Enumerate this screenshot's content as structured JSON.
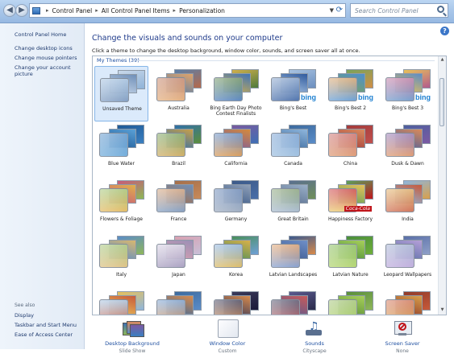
{
  "address": {
    "crumbs": [
      "Control Panel",
      "All Control Panel Items",
      "Personalization"
    ]
  },
  "search": {
    "placeholder": "Search Control Panel"
  },
  "sidebar": {
    "home": "Control Panel Home",
    "links": [
      "Change desktop icons",
      "Change mouse pointers",
      "Change your account picture"
    ],
    "see_also_label": "See also",
    "see_also": [
      "Display",
      "Taskbar and Start Menu",
      "Ease of Access Center"
    ]
  },
  "main": {
    "title": "Change the visuals and sounds on your computer",
    "subtitle": "Click a theme to change the desktop background, window color, sounds, and screen saver all at once.",
    "group_title": "My Themes (39)"
  },
  "themes": [
    {
      "name": "Unsaved Theme",
      "colors": [
        "#8fb3d8",
        "#6f8fb8",
        "#c9d8ea"
      ],
      "selected": true
    },
    {
      "name": "Australia",
      "colors": [
        "#b6694a",
        "#e0a36a",
        "#5a7fa8"
      ]
    },
    {
      "name": "Bing Earth Day Photo Contest Finalists",
      "colors": [
        "#4d7a3d",
        "#3f73b7",
        "#d1b04c"
      ]
    },
    {
      "name": "Bing's Best",
      "colors": [
        "#6b8ebf",
        "#2f5a9e",
        "#a9c4e2"
      ],
      "bing": true
    },
    {
      "name": "Bing's Best 2",
      "colors": [
        "#d18f47",
        "#4e8fcf",
        "#7aa35a"
      ],
      "bing": true
    },
    {
      "name": "Bing's Best 3",
      "colors": [
        "#b25b8d",
        "#5d8cc4",
        "#e8c15a"
      ],
      "bing": true
    },
    {
      "name": "Blue Water",
      "colors": [
        "#3a7fc0",
        "#5aa0d6",
        "#1f5a96"
      ]
    },
    {
      "name": "Brazil",
      "colors": [
        "#5d8e3b",
        "#c8a04a",
        "#2f6fa8"
      ]
    },
    {
      "name": "California",
      "colors": [
        "#3e6fb5",
        "#d48a3c",
        "#7a5a9e"
      ]
    },
    {
      "name": "Canada",
      "colors": [
        "#5a8cc8",
        "#8fb6dc",
        "#3c6a9e"
      ]
    },
    {
      "name": "China",
      "colors": [
        "#c0504d",
        "#d98c5f",
        "#a33a3a"
      ]
    },
    {
      "name": "Dusk & Dawn",
      "colors": [
        "#7c5aa3",
        "#d98a5a",
        "#4d5f9e"
      ]
    },
    {
      "name": "Flowers & Foliage",
      "colors": [
        "#8db856",
        "#e1b04a",
        "#c85a7a"
      ]
    },
    {
      "name": "France",
      "colors": [
        "#c88a5a",
        "#6f8fb8",
        "#a56f4a"
      ]
    },
    {
      "name": "Germany",
      "colors": [
        "#4a6fa8",
        "#8fa0b8",
        "#3c5a88"
      ]
    },
    {
      "name": "Great Britain",
      "colors": [
        "#6f8f5a",
        "#9ab0c8",
        "#5a6f8f"
      ]
    },
    {
      "name": "Happiness Factory",
      "colors": [
        "#c0151b",
        "#e8c15a",
        "#5aa05a"
      ],
      "coke": true
    },
    {
      "name": "India",
      "colors": [
        "#d9a04a",
        "#c85a3a",
        "#8fb6dc"
      ]
    },
    {
      "name": "Italy",
      "colors": [
        "#8fb65a",
        "#d9b86f",
        "#5a8cc8"
      ]
    },
    {
      "name": "Japan",
      "colors": [
        "#c8c0d8",
        "#9a8fb6",
        "#d8a0b0"
      ]
    },
    {
      "name": "Korea",
      "colors": [
        "#6fa0d8",
        "#d8b04a",
        "#4a8f5a"
      ]
    },
    {
      "name": "Latvian Landscapes",
      "colors": [
        "#d88a4a",
        "#6f8fc8",
        "#3c5a8f"
      ]
    },
    {
      "name": "Latvian Nature",
      "colors": [
        "#6fae3a",
        "#a8d05a",
        "#4a8f3a"
      ]
    },
    {
      "name": "Leopard Wallpapers",
      "colors": [
        "#8fa0c8",
        "#b6a0d8",
        "#5a6fa8"
      ]
    },
    {
      "name": "",
      "colors": [
        "#8fb6dc",
        "#c85a3a",
        "#e8c15a"
      ]
    },
    {
      "name": "",
      "colors": [
        "#5a8cc8",
        "#d88a4a",
        "#3c6a9e"
      ]
    },
    {
      "name": "",
      "colors": [
        "#1a1a3a",
        "#d88a4a",
        "#3a3a5a"
      ]
    },
    {
      "name": "",
      "colors": [
        "#2a2a4a",
        "#c85a5a",
        "#5a5a8f"
      ]
    },
    {
      "name": "",
      "colors": [
        "#8fb65a",
        "#a8d05a",
        "#5a8f3a"
      ]
    },
    {
      "name": "",
      "colors": [
        "#c85a3a",
        "#d8a04a",
        "#8f3a2a"
      ]
    }
  ],
  "bottom_bar": [
    {
      "label": "Desktop Background",
      "value": "Slide Show",
      "icon": "desktop-background-icon"
    },
    {
      "label": "Window Color",
      "value": "Custom",
      "icon": "window-color-icon"
    },
    {
      "label": "Sounds",
      "value": "Cityscape",
      "icon": "sounds-icon"
    },
    {
      "label": "Screen Saver",
      "value": "None",
      "icon": "screen-saver-icon"
    }
  ]
}
